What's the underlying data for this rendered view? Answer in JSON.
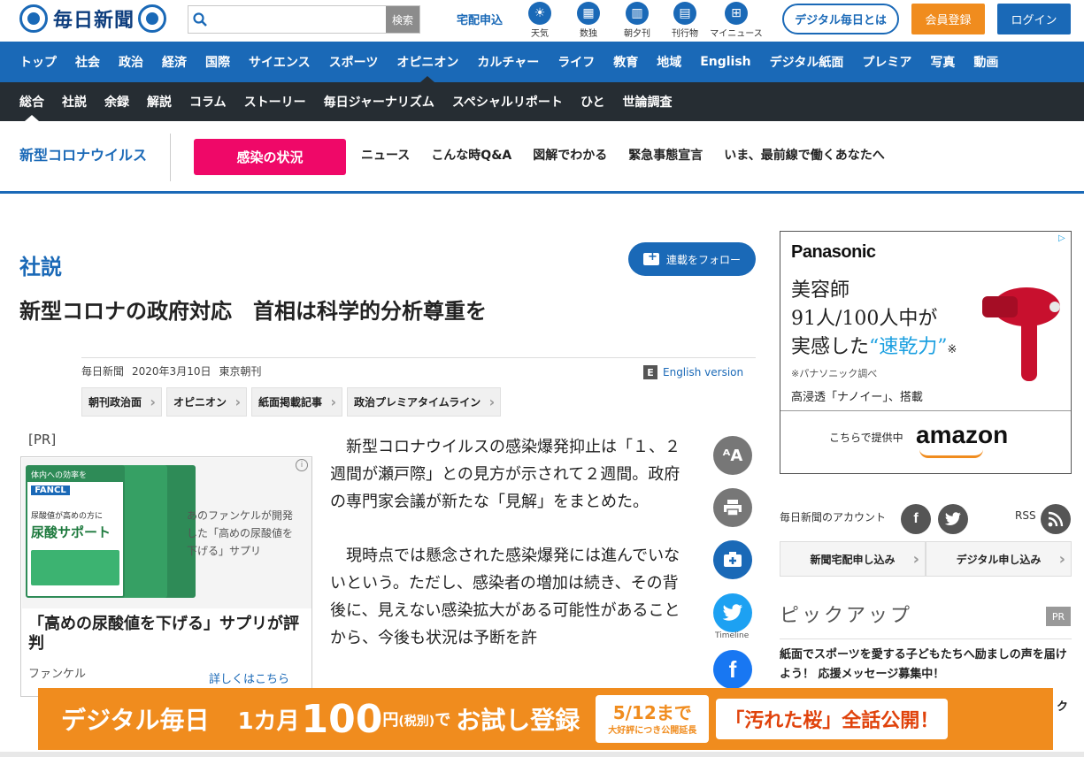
{
  "header": {
    "logo_text": "毎日新聞",
    "search_placeholder": "",
    "search_button": "検索",
    "takuhai": "宅配申込",
    "quick_links": [
      {
        "label": "天気",
        "icon": "weather-icon"
      },
      {
        "label": "数独",
        "icon": "sudoku-icon"
      },
      {
        "label": "朝夕刊",
        "icon": "newspaper-icon"
      },
      {
        "label": "刊行物",
        "icon": "book-icon"
      },
      {
        "label": "マイニュース",
        "icon": "my-news-icon"
      }
    ],
    "digital_button": "デジタル毎日とは",
    "member_button": "会員登録",
    "login_button": "ログイン"
  },
  "nav_primary": [
    "トップ",
    "社会",
    "政治",
    "経済",
    "国際",
    "サイエンス",
    "スポーツ",
    "オピニオン",
    "カルチャー",
    "ライフ",
    "教育",
    "地域",
    "English",
    "デジタル紙面",
    "プレミア",
    "写真",
    "動画"
  ],
  "nav_primary_active": "オピニオン",
  "nav_secondary": [
    "総合",
    "社説",
    "余録",
    "解説",
    "コラム",
    "ストーリー",
    "毎日ジャーナリズム",
    "スペシャルリポート",
    "ひと",
    "世論調査"
  ],
  "nav_secondary_active": "総合",
  "corona_bar": {
    "title": "新型コロナウイルス",
    "button": "感染の状況",
    "links": [
      "ニュース",
      "こんな時Q&A",
      "図解でわかる",
      "緊急事態宣言",
      "いま、最前線で働くあなたへ"
    ]
  },
  "article": {
    "category": "社説",
    "follow_button": "連載をフォロー",
    "headline": "新型コロナの政府対応　首相は科学的分析尊重を",
    "source": "毎日新聞",
    "date": "2020年3月10日",
    "edition": "東京朝刊",
    "english_version": "English version",
    "english_icon": "E",
    "tags": [
      "朝刊政治面",
      "オピニオン",
      "紙面掲載記事",
      "政治プレミアタイムライン"
    ],
    "paragraphs": [
      "新型コロナウイルスの感染爆発抑止は「１、２週間が瀬戸際」との見方が示されて２週間。政府の専門家会議が新たな「見解」をまとめた。",
      "現時点では懸念された感染爆発には進んでいないという。ただし、感染者の増加は続き、その背後に、見えない感染拡大がある可能性があることから、今後も状況は予断を許"
    ]
  },
  "share_buttons": [
    {
      "name": "font-size-icon",
      "text": "ᴬA",
      "color": "#777777"
    },
    {
      "name": "print-icon",
      "text": "",
      "color": "#777777"
    },
    {
      "name": "mybox-add-icon",
      "text": "",
      "color": "#1a69b7"
    },
    {
      "name": "twitter-icon",
      "text": "Timeline",
      "color": "#1da1f2"
    },
    {
      "name": "facebook-icon",
      "text": "f",
      "color": "#1877f2"
    }
  ],
  "ad_left": {
    "pr_label": "[PR]",
    "badge_text": "体内への効率を",
    "brand_box": "FANCL",
    "product_line1": "尿酸値が高めの方に",
    "product_name": "尿酸サポート",
    "caption": "あのファンケルが開発した「高めの尿酸値を下げる」サプリ",
    "title": "「高めの尿酸値を下げる」サプリが評判",
    "brand": "ファンケル",
    "more": "詳しくはこちら"
  },
  "ad_right": {
    "brand": "Panasonic",
    "line1": "美容師",
    "line2": "91人/100人中が",
    "line3_pre": "実感した",
    "line3_hl": "“速乾力”",
    "line3_post": "※",
    "note": "※パナソニック調べ",
    "line5": "高浸透「ナノイー」、搭載",
    "provided": "こちらで提供中",
    "amazon": "amazon"
  },
  "sidebar": {
    "account_label": "毎日新聞のアカウント",
    "rss": "RSS",
    "delivery_button": "新聞宅配申し込み",
    "digital_apply_button": "デジタル申し込み",
    "pickup_title": "ピックアップ",
    "pr_badge": "PR",
    "pickup_item": "紙面でスポーツを愛する子どもたちへ励ましの声を届けよう！ 応援メッセージ募集中！",
    "pickup_next": "ク"
  },
  "banner": {
    "part1": "デジタル毎日",
    "part2": "1カ月",
    "price": "100",
    "yen": "円",
    "tax": "(税別)",
    "de": "で",
    "trial": "お試し登録",
    "date": "5/12まで",
    "date_note": "大好評につき公開延長",
    "promo": "「汚れた桜」全話公開！"
  },
  "colors": {
    "brand_blue": "#1a69b7",
    "dark_nav": "#262d33",
    "corona_pink": "#ef0868",
    "banner_orange": "#f08c1e"
  }
}
